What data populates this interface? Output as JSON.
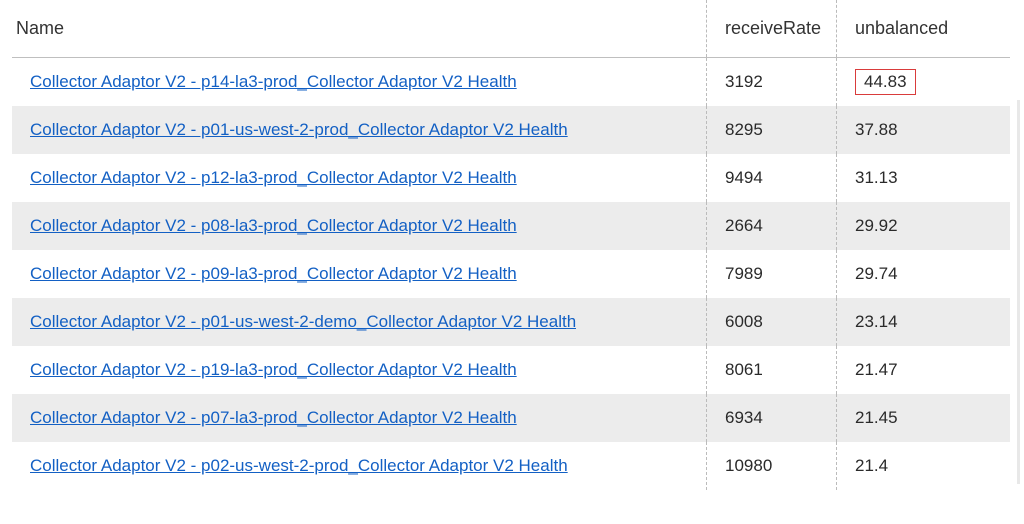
{
  "table": {
    "columns": {
      "name": "Name",
      "receiveRate": "receiveRate",
      "unbalanced": "unbalanced"
    },
    "rows": [
      {
        "name": "Collector Adaptor V2 - p14-la3-prod_Collector Adaptor V2 Health",
        "receiveRate": "3192",
        "unbalanced": "44.83",
        "highlight": true
      },
      {
        "name": "Collector Adaptor V2 - p01-us-west-2-prod_Collector Adaptor V2 Health",
        "receiveRate": "8295",
        "unbalanced": "37.88",
        "highlight": false
      },
      {
        "name": "Collector Adaptor V2 - p12-la3-prod_Collector Adaptor V2 Health",
        "receiveRate": "9494",
        "unbalanced": "31.13",
        "highlight": false
      },
      {
        "name": "Collector Adaptor V2 - p08-la3-prod_Collector Adaptor V2 Health",
        "receiveRate": "2664",
        "unbalanced": "29.92",
        "highlight": false
      },
      {
        "name": "Collector Adaptor V2 - p09-la3-prod_Collector Adaptor V2 Health",
        "receiveRate": "7989",
        "unbalanced": "29.74",
        "highlight": false
      },
      {
        "name": "Collector Adaptor V2 - p01-us-west-2-demo_Collector Adaptor V2 Health",
        "receiveRate": "6008",
        "unbalanced": "23.14",
        "highlight": false
      },
      {
        "name": "Collector Adaptor V2 - p19-la3-prod_Collector Adaptor V2 Health",
        "receiveRate": "8061",
        "unbalanced": "21.47",
        "highlight": false
      },
      {
        "name": "Collector Adaptor V2 - p07-la3-prod_Collector Adaptor V2 Health",
        "receiveRate": "6934",
        "unbalanced": "21.45",
        "highlight": false
      },
      {
        "name": "Collector Adaptor V2 - p02-us-west-2-prod_Collector Adaptor V2 Health",
        "receiveRate": "10980",
        "unbalanced": "21.4",
        "highlight": false
      }
    ]
  }
}
